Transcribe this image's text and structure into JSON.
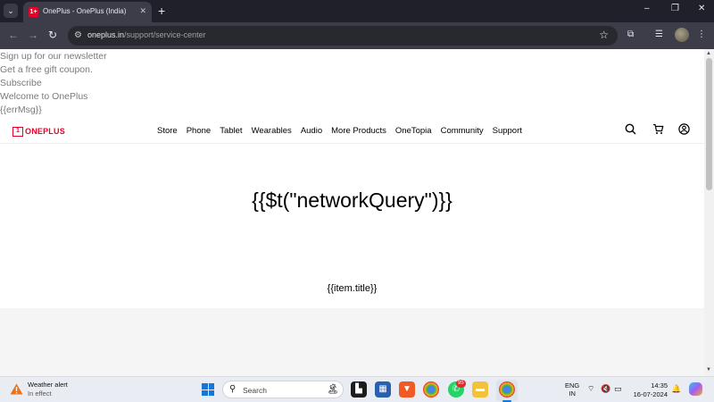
{
  "browser": {
    "tab": {
      "title": "OnePlus - OnePlus (India)",
      "favicon_text": "1+"
    },
    "new_tab_label": "+",
    "window_controls": {
      "minimize": "–",
      "restore": "❐",
      "close": "✕"
    },
    "url": {
      "host": "oneplus.in",
      "path": "/support/service-center"
    }
  },
  "page": {
    "newsletter": {
      "signup_text": "Sign up for our newsletter",
      "gift_text": "Get a free gift coupon.",
      "subscribe_label": "Subscribe",
      "welcome_text": "Welcome to OnePlus",
      "error_msg": "{{errMsg}}"
    },
    "header": {
      "logo_mark": "1",
      "logo_text": "ONEPLUS",
      "nav": [
        "Store",
        "Phone",
        "Tablet",
        "Wearables",
        "Audio",
        "More Products",
        "OneTopia",
        "Community",
        "Support"
      ]
    },
    "heading": "{{$t(\"networkQuery\")}}",
    "item_title": "{{item.title}}"
  },
  "taskbar": {
    "weather": {
      "title": "Weather alert",
      "subtitle": "In effect"
    },
    "search_label": "Search",
    "whatsapp_badge": "95",
    "language": {
      "line1": "ENG",
      "line2": "IN"
    },
    "clock": {
      "time": "14:35",
      "date": "16-07-2024"
    }
  },
  "colors": {
    "brand_red": "#eb0029",
    "chrome_dark": "#1f2029",
    "taskbar": "#e9edf3"
  }
}
